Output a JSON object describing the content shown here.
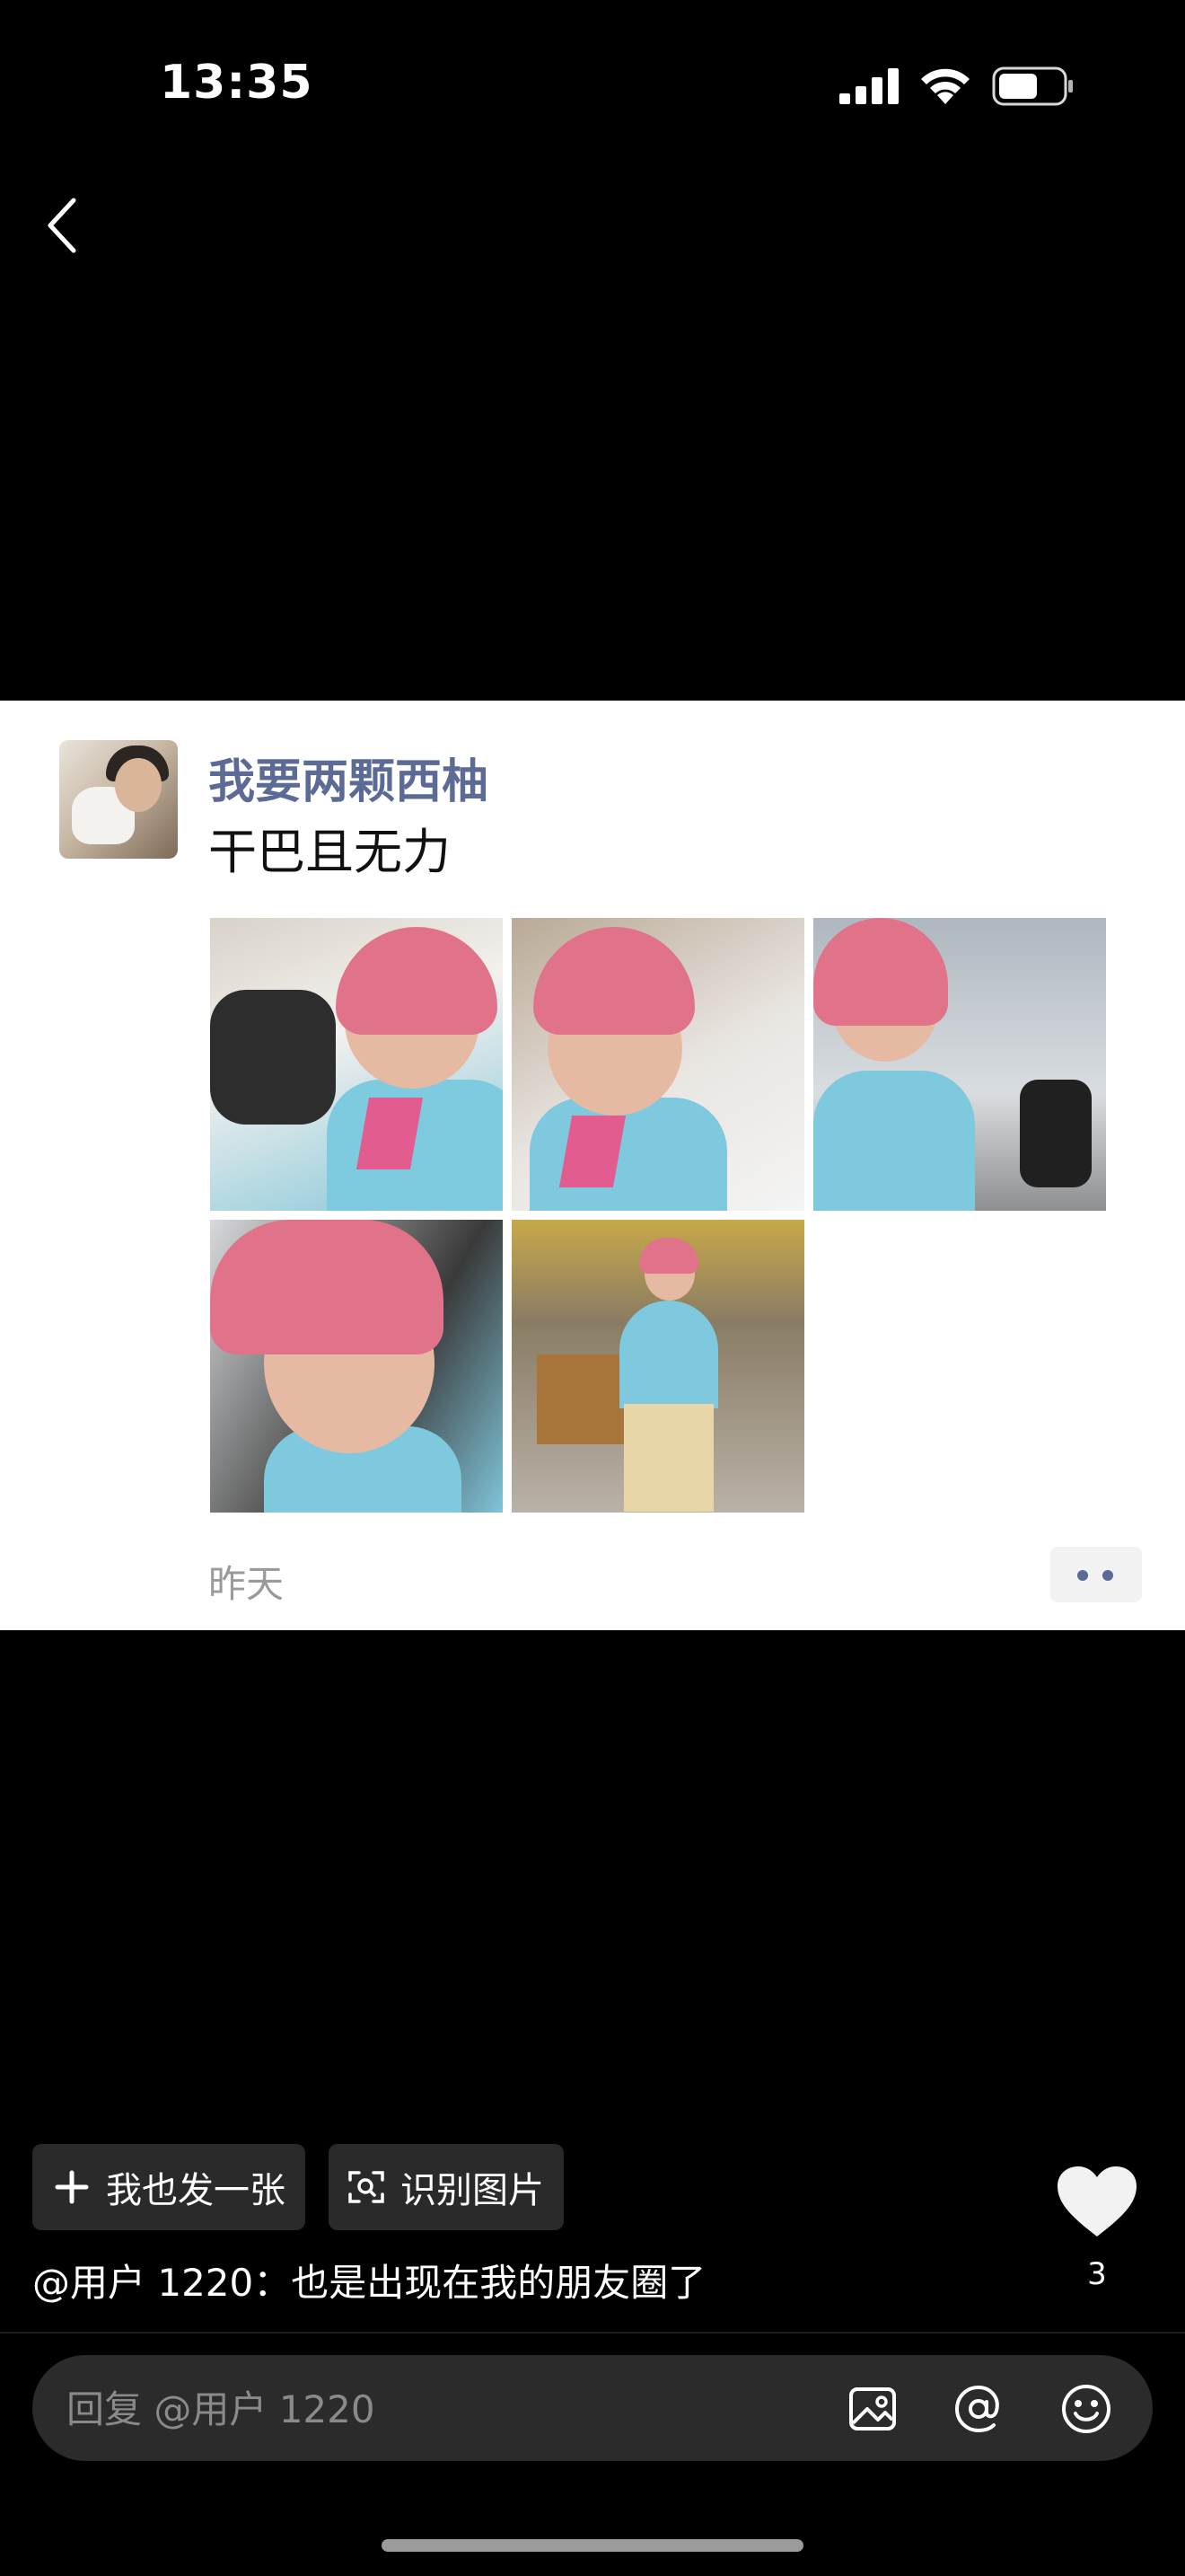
{
  "status_bar": {
    "time": "13:35",
    "icons": [
      "signal-icon",
      "wifi-icon",
      "battery-icon"
    ]
  },
  "nav": {
    "back_icon": "chevron-left-icon"
  },
  "shared_post": {
    "author": "我要两颗西柚",
    "text": "干巴且无力",
    "photos": [
      "photo-1",
      "photo-2",
      "photo-3",
      "photo-4",
      "photo-5"
    ],
    "time": "昨天",
    "more_icon": "more-dots-icon",
    "accent_color": "#5b6b96"
  },
  "actions": {
    "post_too_label": "我也发一张",
    "recognize_label": "识别图片"
  },
  "comment": {
    "text": "@用户 1220：也是出现在我的朋友圈了"
  },
  "like": {
    "icon": "heart-icon",
    "count": "3"
  },
  "reply": {
    "placeholder": "回复 @用户 1220",
    "icons": [
      "image-icon",
      "at-icon",
      "emoji-icon"
    ]
  }
}
